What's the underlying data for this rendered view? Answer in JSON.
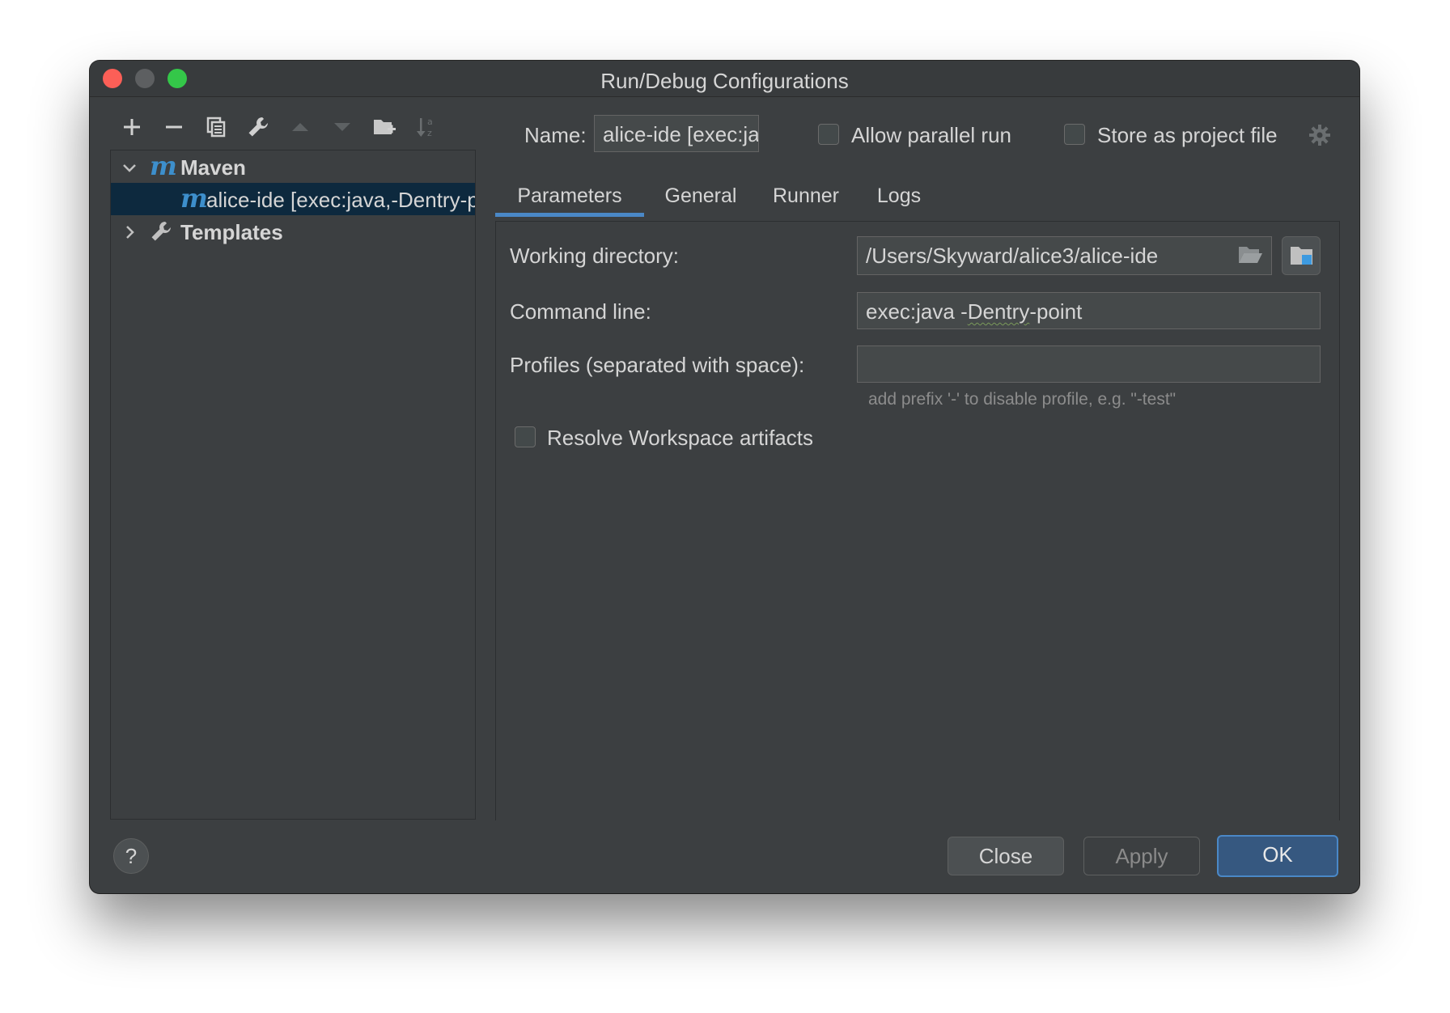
{
  "window": {
    "title": "Run/Debug Configurations"
  },
  "toolbar": {
    "icons": [
      "plus-icon",
      "minus-icon",
      "copy-icon",
      "wrench-icon",
      "arrow-up-icon",
      "arrow-down-icon",
      "folder-add-icon",
      "sort-az-icon"
    ]
  },
  "tree": {
    "maven": {
      "label": "Maven",
      "badge": "m"
    },
    "config": {
      "label": "alice-ide [exec:java,-Dentry-point]",
      "badge": "m"
    },
    "templates": {
      "label": "Templates"
    }
  },
  "header": {
    "name_label": "Name:",
    "name_value": "alice-ide [exec:java,-Dentry-point]",
    "allow_parallel": "Allow parallel run",
    "store_project": "Store as project file"
  },
  "tabs": [
    {
      "label": "Parameters"
    },
    {
      "label": "General"
    },
    {
      "label": "Runner"
    },
    {
      "label": "Logs"
    }
  ],
  "form": {
    "working_dir_label": "Working directory:",
    "working_dir_value": "/Users/Skyward/alice3/alice-ide",
    "command_line_label": "Command line:",
    "command_prefix": "exec:java -",
    "command_squiggle": "Dentry",
    "command_suffix": "-point",
    "profiles_label": "Profiles (separated with space):",
    "profiles_value": "",
    "profiles_hint": "add prefix '-' to disable profile, e.g. \"-test\"",
    "resolve_label": "Resolve Workspace artifacts"
  },
  "footer": {
    "help": "?",
    "close": "Close",
    "apply": "Apply",
    "ok": "OK"
  },
  "colors": {
    "background": "#3c3f41",
    "accent": "#4a88c7",
    "selection": "#0d293e",
    "maven_blue": "#3d8fcc"
  }
}
